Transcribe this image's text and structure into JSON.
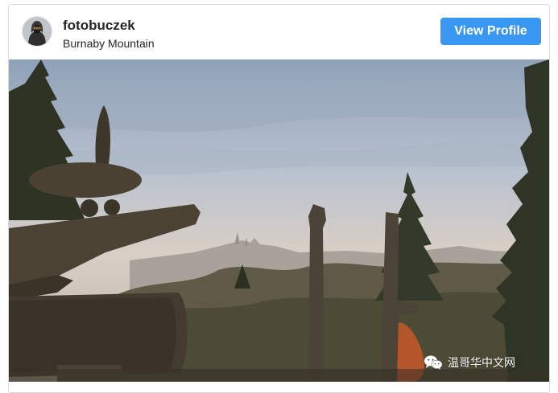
{
  "post": {
    "username": "fotobuczek",
    "location": "Burnaby Mountain",
    "view_profile_label": "View Profile",
    "avatar_icon": "hooded-person-avatar",
    "photo_description_icon": "landscape-photo"
  },
  "watermark": {
    "icon": "wechat-icon",
    "text": "温哥华中文网"
  },
  "colors": {
    "accent": "#3897f0",
    "text": "#262626",
    "border": "#dbdbdb"
  }
}
